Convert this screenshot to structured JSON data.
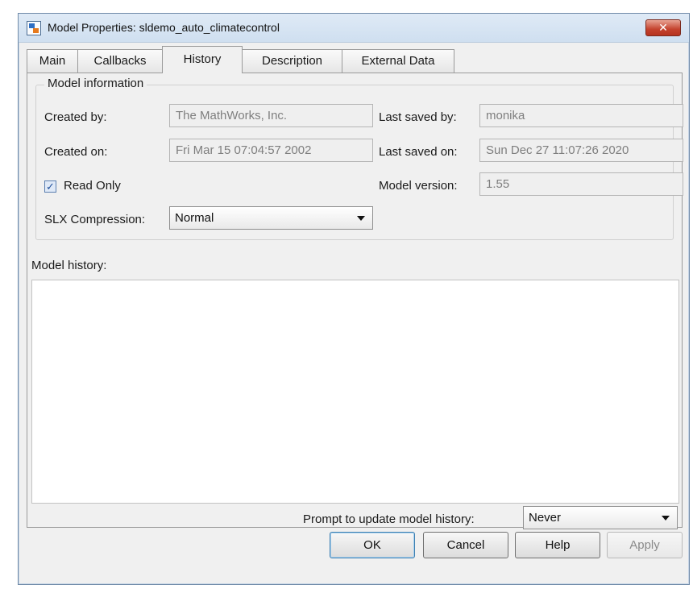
{
  "window": {
    "title": "Model Properties: sldemo_auto_climatecontrol",
    "close_glyph": "✕"
  },
  "tabs": [
    {
      "label": "Main"
    },
    {
      "label": "Callbacks"
    },
    {
      "label": "History",
      "active": true
    },
    {
      "label": "Description"
    },
    {
      "label": "External Data"
    }
  ],
  "model_info": {
    "legend": "Model information",
    "created_by_label": "Created by:",
    "created_by_value": "The MathWorks, Inc.",
    "created_on_label": "Created on:",
    "created_on_value": "Fri Mar 15 07:04:57 2002",
    "last_saved_by_label": "Last saved by:",
    "last_saved_by_value": "monika",
    "last_saved_on_label": "Last saved on:",
    "last_saved_on_value": "Sun Dec 27 11:07:26 2020",
    "read_only_label": "Read Only",
    "read_only_checked": true,
    "check_glyph": "✓",
    "model_version_label": "Model version:",
    "model_version_value": "1.55",
    "slx_compression_label": "SLX Compression:",
    "slx_compression_value": "Normal"
  },
  "history": {
    "label": "Model history:",
    "content": "",
    "prompt_label": "Prompt to update model history:",
    "prompt_value": "Never"
  },
  "buttons": {
    "ok": "OK",
    "cancel": "Cancel",
    "help": "Help",
    "apply": "Apply"
  }
}
